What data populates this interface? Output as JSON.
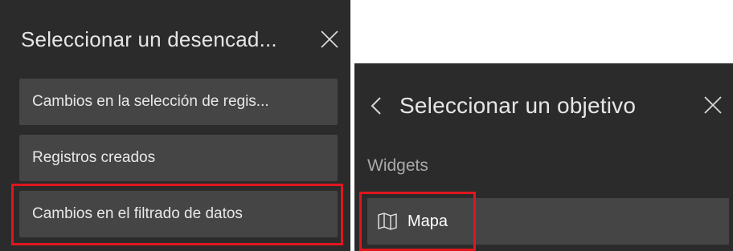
{
  "trigger_panel": {
    "title": "Seleccionar un desencad...",
    "close_icon": "close-icon",
    "options": [
      {
        "label": "Cambios en la selección de regis..."
      },
      {
        "label": "Registros creados"
      },
      {
        "label": "Cambios en el filtrado de datos",
        "highlighted": true
      }
    ]
  },
  "target_panel": {
    "back_icon": "chevron-left-icon",
    "title": "Seleccionar un objetivo",
    "close_icon": "close-icon",
    "section_label": "Widgets",
    "widgets": [
      {
        "icon": "map-icon",
        "label": "Mapa",
        "highlighted": true
      }
    ]
  },
  "colors": {
    "panel_background": "#2b2b2b",
    "button_background": "#454545",
    "text": "#e8e8e8",
    "section_text": "#a8a8a8",
    "highlight": "#e0161d"
  }
}
